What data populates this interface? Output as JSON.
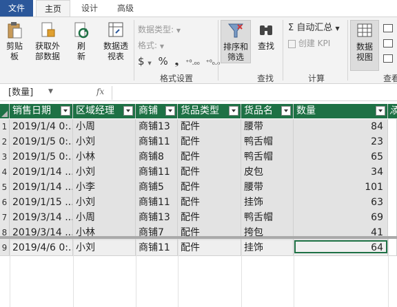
{
  "menu": {
    "tabs": [
      "文件",
      "主页",
      "设计",
      "高级"
    ]
  },
  "ribbon": {
    "clipboard": {
      "line1": "剪贴",
      "line2": "板"
    },
    "get_data": {
      "line1": "获取外",
      "line2": "部数据"
    },
    "refresh": {
      "line1": "刷",
      "line2": "新"
    },
    "pivot": {
      "line1": "数据透",
      "line2": "视表"
    },
    "data_type_label": "数据类型:",
    "format_label": "格式:",
    "currency_symbol": "$",
    "percent_symbol": "%",
    "comma_symbol": "❟",
    "dec_increase": "⁺⁰.₀₀",
    "dec_decrease": "⁺⁰₀.₀",
    "format_group_label": "格式设置",
    "sort_filter": {
      "line1": "排序和",
      "line2": "筛选"
    },
    "find": "查找",
    "find_group_label": "查找",
    "autosum": "Σ 自动汇总",
    "create_kpi": "创建 KPI",
    "calc_group_label": "计算",
    "data_view": {
      "line1": "数据",
      "line2": "视图"
    },
    "view_group_label": "查看"
  },
  "formula_bar": {
    "name_box": "[数量]",
    "fx": "fx"
  },
  "grid": {
    "headers": [
      "销售日期",
      "区域经理",
      "商铺",
      "货品类型",
      "货品名",
      "数量"
    ],
    "extra_header": "添",
    "rows": [
      {
        "n": "1",
        "date": "2019/1/4 0:...",
        "manager": "小周",
        "shop": "商铺13",
        "type": "配件",
        "item": "腰带",
        "qty": "84"
      },
      {
        "n": "2",
        "date": "2019/1/5 0:...",
        "manager": "小刘",
        "shop": "商铺11",
        "type": "配件",
        "item": "鸭舌帽",
        "qty": "23"
      },
      {
        "n": "3",
        "date": "2019/1/5 0:...",
        "manager": "小林",
        "shop": "商铺8",
        "type": "配件",
        "item": "鸭舌帽",
        "qty": "65"
      },
      {
        "n": "4",
        "date": "2019/1/14 ...",
        "manager": "小刘",
        "shop": "商铺11",
        "type": "配件",
        "item": "皮包",
        "qty": "34"
      },
      {
        "n": "5",
        "date": "2019/1/14 ...",
        "manager": "小李",
        "shop": "商铺5",
        "type": "配件",
        "item": "腰带",
        "qty": "101"
      },
      {
        "n": "6",
        "date": "2019/1/15 ...",
        "manager": "小刘",
        "shop": "商铺11",
        "type": "配件",
        "item": "挂饰",
        "qty": "63"
      },
      {
        "n": "7",
        "date": "2019/3/14 ...",
        "manager": "小周",
        "shop": "商铺13",
        "type": "配件",
        "item": "鸭舌帽",
        "qty": "69"
      },
      {
        "n": "8",
        "date": "2019/3/14 ...",
        "manager": "小林",
        "shop": "商铺7",
        "type": "配件",
        "item": "挎包",
        "qty": "41"
      },
      {
        "n": "9",
        "date": "2019/4/6 0:...",
        "manager": "小刘",
        "shop": "商铺11",
        "type": "配件",
        "item": "挂饰",
        "qty": "64"
      }
    ]
  },
  "colors": {
    "header_green": "#1e7145",
    "file_tab_blue": "#2b579a"
  }
}
